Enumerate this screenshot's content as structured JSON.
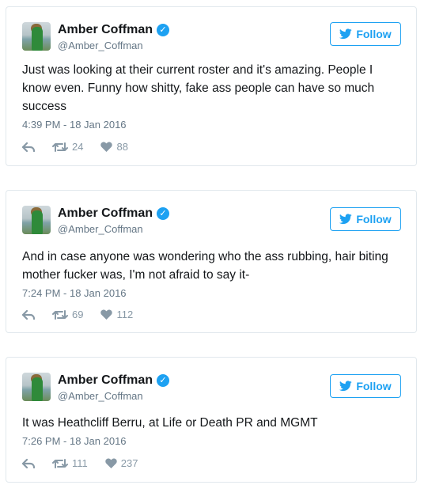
{
  "tweets": [
    {
      "name": "Amber Coffman",
      "handle": "@Amber_Coffman",
      "follow_label": "Follow",
      "text": "Just was looking at their current roster and it's amazing. People I know even. Funny how shitty, fake ass people can have so much success",
      "timestamp": "4:39 PM - 18 Jan 2016",
      "retweets": "24",
      "likes": "88"
    },
    {
      "name": "Amber Coffman",
      "handle": "@Amber_Coffman",
      "follow_label": "Follow",
      "text": "And in case anyone was wondering who the ass rubbing, hair biting mother fucker was, I'm not afraid to say it-",
      "timestamp": "7:24 PM - 18 Jan 2016",
      "retweets": "69",
      "likes": "112"
    },
    {
      "name": "Amber Coffman",
      "handle": "@Amber_Coffman",
      "follow_label": "Follow",
      "text": "It was Heathcliff Berru, at Life or Death PR and MGMT",
      "timestamp": "7:26 PM - 18 Jan 2016",
      "retweets": "111",
      "likes": "237"
    }
  ],
  "colors": {
    "accent": "#1da1f2",
    "secondary_text": "#657786",
    "action_icons": "#8899a6",
    "border": "#e1e8ed"
  }
}
